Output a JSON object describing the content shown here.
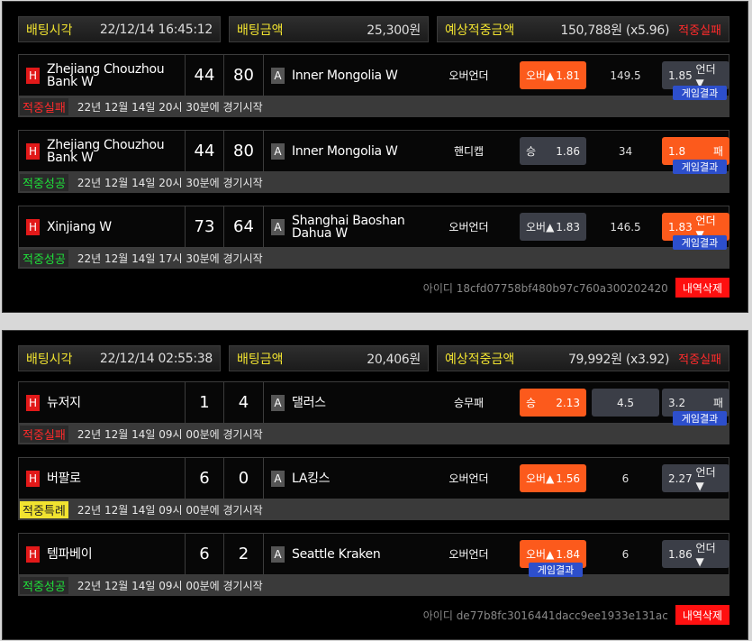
{
  "labels": {
    "bet_time": "배팅시각",
    "bet_amount": "배팅금액",
    "expected_payout": "예상적중금액",
    "game_result": "게임결과",
    "id_prefix": "아이디",
    "delete": "내역삭제",
    "home_badge": "H",
    "away_badge": "A"
  },
  "tickets": [
    {
      "time": "22/12/14 16:45:12",
      "amount": "25,300원",
      "payout": "150,788원 (x5.96)",
      "result": "적중실패",
      "id": "18cfd07758bf480b97c760a300202420",
      "games": [
        {
          "home": "Zhejiang Chouzhou Bank W",
          "home_score": "44",
          "away_score": "80",
          "away": "Inner Mongolia W",
          "type": "오버언더",
          "opt1_label": "오버▲",
          "opt1_odds": "1.81",
          "mid": "149.5",
          "opt3_label": "언더▼",
          "opt3_odds": "1.85",
          "status": "적중실패",
          "start": "22년 12월 14일 20시 30분에 경기시작"
        },
        {
          "home": "Zhejiang Chouzhou Bank W",
          "home_score": "44",
          "away_score": "80",
          "away": "Inner Mongolia W",
          "type": "핸디캡",
          "opt1_label": "승",
          "opt1_odds": "1.86",
          "mid": "34",
          "opt3_label": "패",
          "opt3_odds": "1.8",
          "status": "적중성공",
          "start": "22년 12월 14일 20시 30분에 경기시작"
        },
        {
          "home": "Xinjiang W",
          "home_score": "73",
          "away_score": "64",
          "away": "Shanghai Baoshan Dahua W",
          "type": "오버언더",
          "opt1_label": "오버▲",
          "opt1_odds": "1.83",
          "mid": "146.5",
          "opt3_label": "언더▼",
          "opt3_odds": "1.83",
          "status": "적중성공",
          "start": "22년 12월 14일 17시 30분에 경기시작"
        }
      ]
    },
    {
      "time": "22/12/14 02:55:38",
      "amount": "20,406원",
      "payout": "79,992원 (x3.92)",
      "result": "적중실패",
      "id": "de77b8fc3016441dacc9ee1933e131ac",
      "games": [
        {
          "home": "뉴저지",
          "home_score": "1",
          "away_score": "4",
          "away": "댈러스",
          "type": "승무패",
          "opt1_label": "승",
          "opt1_odds": "2.13",
          "mid": "4.5",
          "opt3_label": "패",
          "opt3_odds": "3.2",
          "status": "적중실패",
          "start": "22년 12월 14일 09시 00분에 경기시작"
        },
        {
          "home": "버팔로",
          "home_score": "6",
          "away_score": "0",
          "away": "LA킹스",
          "type": "오버언더",
          "opt1_label": "오버▲",
          "opt1_odds": "1.56",
          "mid": "6",
          "opt3_label": "언더▼",
          "opt3_odds": "2.27",
          "status": "적중특례",
          "start": "22년 12월 14일 09시 00분에 경기시작"
        },
        {
          "home": "템파베이",
          "home_score": "6",
          "away_score": "2",
          "away": "Seattle Kraken",
          "type": "오버언더",
          "opt1_label": "오버▲",
          "opt1_odds": "1.84",
          "mid": "6",
          "opt3_label": "언더▼",
          "opt3_odds": "1.86",
          "status": "적중성공",
          "start": "22년 12월 14일 09시 00분에 경기시작"
        }
      ]
    }
  ],
  "colors": {
    "selected": "#fc5a1c",
    "unselected": "#3b3e47",
    "fail": "#ff2b2b",
    "success": "#1fe03a",
    "special": "#f1e330",
    "label_yellow": "#f1e330",
    "result_tag": "#2d4fcc"
  }
}
